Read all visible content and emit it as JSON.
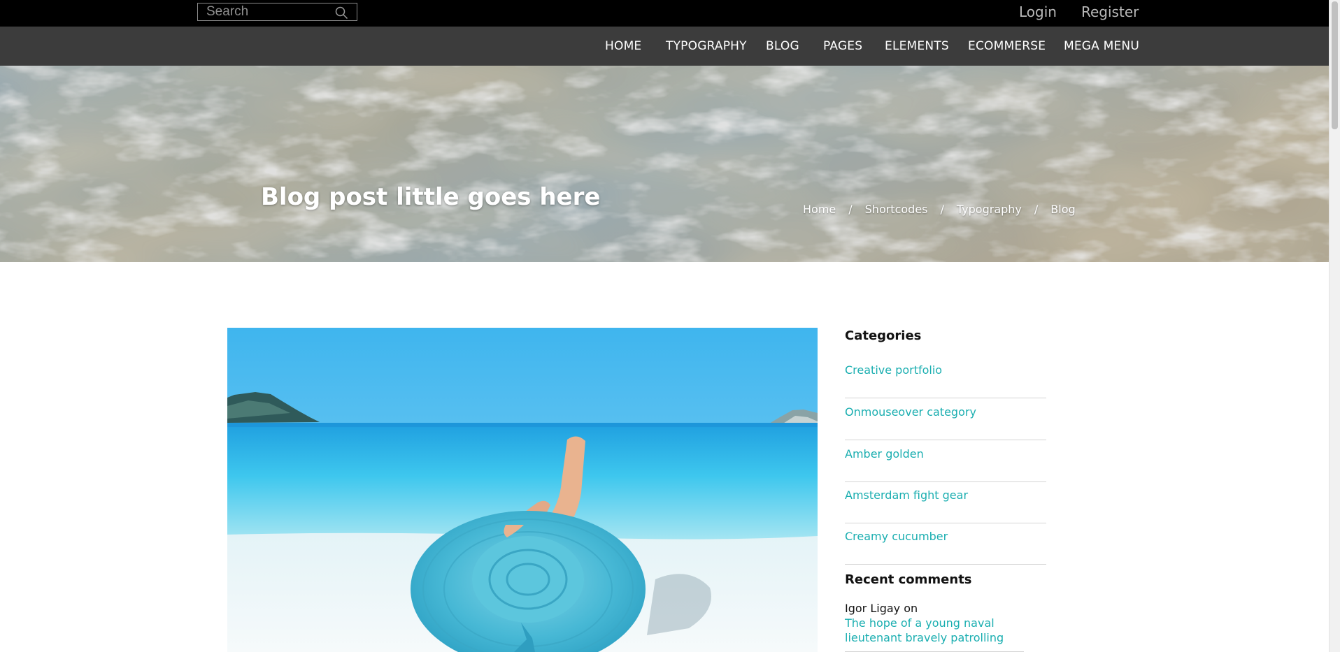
{
  "topbar": {
    "search_placeholder": "Search",
    "search_icon": "magnifier",
    "login_label": "Login",
    "register_label": "Register"
  },
  "nav": {
    "items": [
      "HOME",
      "TYPOGRAPHY",
      "BLOG",
      "PAGES",
      "ELEMENTS",
      "ECOMMERSE",
      "MEGA MENU"
    ]
  },
  "hero": {
    "title": "Blog post little goes here",
    "breadcrumb": [
      "Home",
      "Shortcodes",
      "Typography",
      "Blog"
    ],
    "separator": "/"
  },
  "sidebar": {
    "categories_title": "Categories",
    "categories": [
      "Creative portfolio",
      "Onmouseover category",
      "Amber golden",
      "Amsterdam fight gear",
      "Creamy cucumber"
    ],
    "recent_comments_title": "Recent comments",
    "comments": [
      {
        "author": "Igor Ligay",
        "on": "on",
        "post": "The hope of a young naval lieutenant bravely patrolling"
      }
    ]
  },
  "colors": {
    "accent": "#1aaeb0",
    "topbar_bg": "#000000",
    "navbar_bg": "#3c3c3c"
  }
}
